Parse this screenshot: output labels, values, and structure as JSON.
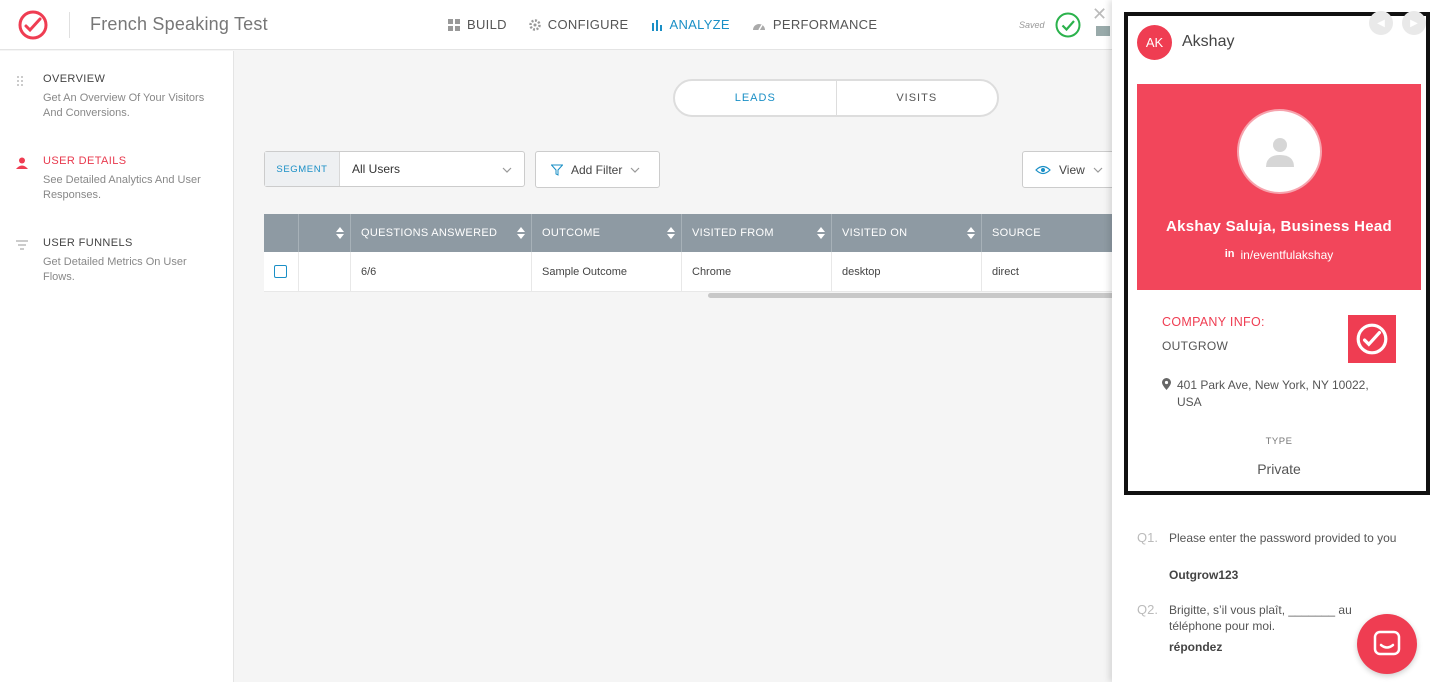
{
  "header": {
    "title": "French Speaking Test",
    "nav": [
      {
        "label": "BUILD",
        "icon": "grid-icon",
        "active": false
      },
      {
        "label": "CONFIGURE",
        "icon": "gear-icon",
        "active": false
      },
      {
        "label": "ANALYZE",
        "icon": "bar-chart-icon",
        "active": true
      },
      {
        "label": "PERFORMANCE",
        "icon": "gauge-icon",
        "active": false
      }
    ],
    "saved_text": "Saved"
  },
  "sidebar": {
    "items": [
      {
        "title": "OVERVIEW",
        "desc": "Get An Overview Of Your Visitors And Conversions.",
        "active": false
      },
      {
        "title": "USER DETAILS",
        "desc": "See Detailed Analytics And User Responses.",
        "active": true
      },
      {
        "title": "USER FUNNELS",
        "desc": "Get Detailed Metrics On User Flows.",
        "active": false
      }
    ]
  },
  "main": {
    "toggle": {
      "leads": "LEADS",
      "visits": "VISITS"
    },
    "segment": {
      "label": "SEGMENT",
      "value": "All Users"
    },
    "add_filter": "Add Filter",
    "view": "View",
    "table": {
      "columns": [
        "QUESTIONS ANSWERED",
        "OUTCOME",
        "VISITED FROM",
        "VISITED ON",
        "SOURCE"
      ],
      "rows": [
        {
          "questions_answered": "6/6",
          "outcome": "Sample Outcome",
          "visited_from": "Chrome",
          "visited_on": "desktop",
          "source": "direct"
        }
      ]
    }
  },
  "panel": {
    "initials": "AK",
    "name": "Akshay",
    "profile_name": "Akshay Saluja, Business Head",
    "linkedin": "in/eventfulakshay",
    "company_label": "COMPANY INFO:",
    "company_name": "OUTGROW",
    "address": "401 Park Ave, New York, NY 10022, USA",
    "type_label": "TYPE",
    "type_value": "Private",
    "questions": [
      {
        "num": "Q1.",
        "text": "Please enter the password provided to you",
        "answer": "Outgrow123"
      },
      {
        "num": "Q2.",
        "text": "Brigitte, s’il vous plaît, _______ au téléphone pour moi.",
        "answer": "répondez"
      }
    ]
  },
  "colors": {
    "brand": "#ef3d52",
    "accent": "#1a8fc6",
    "table_header": "#8e9aa3"
  }
}
